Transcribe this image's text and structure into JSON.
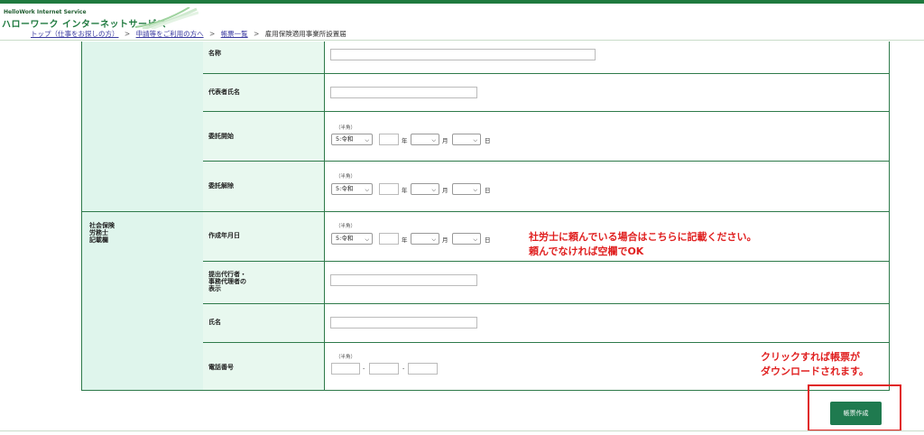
{
  "header": {
    "brand_en": "HelloWork Internet Service",
    "brand_jp": "ハローワーク インターネットサービス"
  },
  "breadcrumb": {
    "items": [
      "トップ（仕事をお探しの方）",
      "申請等をご利用の方へ",
      "帳票一覧",
      "雇用保険適用事業所設置届"
    ],
    "separator": ">"
  },
  "form": {
    "section_label": "社会保険\n労務士\n記載欄",
    "rows": {
      "name": {
        "label": "名称"
      },
      "rep": {
        "label": "代表者氏名"
      },
      "start": {
        "label": "委託開始"
      },
      "end": {
        "label": "委託解除"
      },
      "created": {
        "label": "作成年月日"
      },
      "agent": {
        "label": "提出代行者・\n事務代理者の\n表示"
      },
      "person": {
        "label": "氏名"
      },
      "phone": {
        "label": "電話番号"
      }
    },
    "hint_halfwidth": "（半角）",
    "era_value": "5:令和",
    "unit_year": "年",
    "unit_month": "月",
    "unit_day": "日",
    "dash": "-"
  },
  "annotations": {
    "note1_line1": "社労士に頼んでいる場合はこちらに記載ください。",
    "note1_line2": "頼んでなければ空欄でOK",
    "note2_line1": "クリックすれば帳票が",
    "note2_line2": "ダウンロードされます。"
  },
  "actions": {
    "create_label": "帳票作成"
  },
  "colors": {
    "accent": "#1f7a3f",
    "annotation": "#e02020",
    "label_bg": "#e8f8ef"
  }
}
